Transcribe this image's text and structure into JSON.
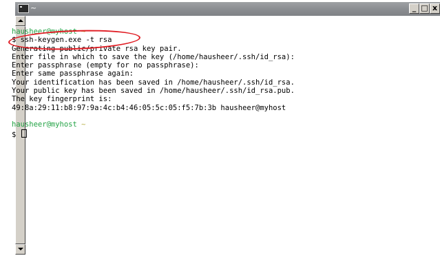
{
  "window": {
    "title": "~",
    "buttons": {
      "minimize": "_",
      "maximize": "□",
      "close": "x"
    }
  },
  "terminal": {
    "prompt1": {
      "user_host": "hausheer@myhost",
      "path": "~"
    },
    "command_line": "$ ssh-keygen.exe -t rsa",
    "output": [
      "Generating public/private rsa key pair.",
      "Enter file in which to save the key (/home/hausheer/.ssh/id_rsa):",
      "Enter passphrase (empty for no passphrase):",
      "Enter same passphrase again:",
      "Your identification has been saved in /home/hausheer/.ssh/id_rsa.",
      "Your public key has been saved in /home/hausheer/.ssh/id_rsa.pub.",
      "The key fingerprint is:",
      "49:8a:29:11:b8:97:9a:4c:b4:46:05:5c:05:f5:7b:3b hausheer@myhost"
    ],
    "prompt2": {
      "user_host": "hausheer@myhost",
      "path": "~"
    },
    "current_input": "$ "
  },
  "colors": {
    "prompt_user_host": "#23a345",
    "prompt_path": "#b8b04a",
    "annotation_oval": "#e01b22",
    "text": "#000000",
    "titlebar": "#8b8e92"
  }
}
